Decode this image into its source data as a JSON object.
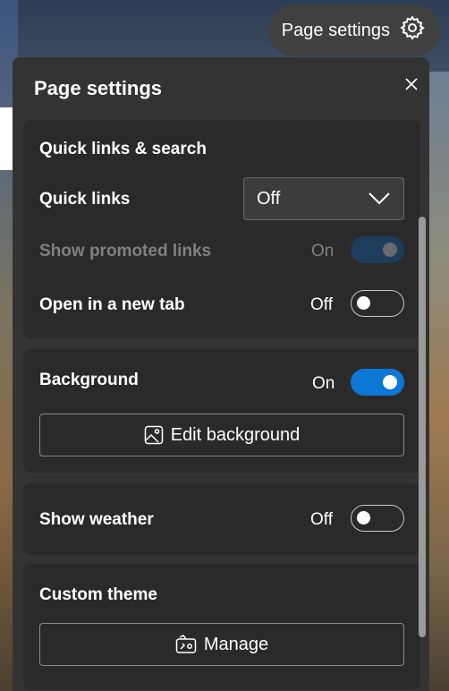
{
  "header": {
    "button_label": "Page settings",
    "button_icon": "gear-icon"
  },
  "panel": {
    "title": "Page settings",
    "close_icon": "close-icon"
  },
  "quick_links_card": {
    "title": "Quick links & search",
    "quick_links": {
      "label": "Quick links",
      "value": "Off"
    },
    "show_promoted": {
      "label": "Show promoted links",
      "state": "On",
      "enabled": false
    },
    "open_new_tab": {
      "label": "Open in a new tab",
      "state": "Off"
    }
  },
  "background_card": {
    "label": "Background",
    "state": "On",
    "edit_button": "Edit background"
  },
  "weather_card": {
    "label": "Show weather",
    "state": "Off"
  },
  "theme_card": {
    "title": "Custom theme",
    "manage_button": "Manage"
  },
  "colors": {
    "accent": "#0a78d4",
    "panel": "#333333",
    "card": "#2a2a2a"
  }
}
